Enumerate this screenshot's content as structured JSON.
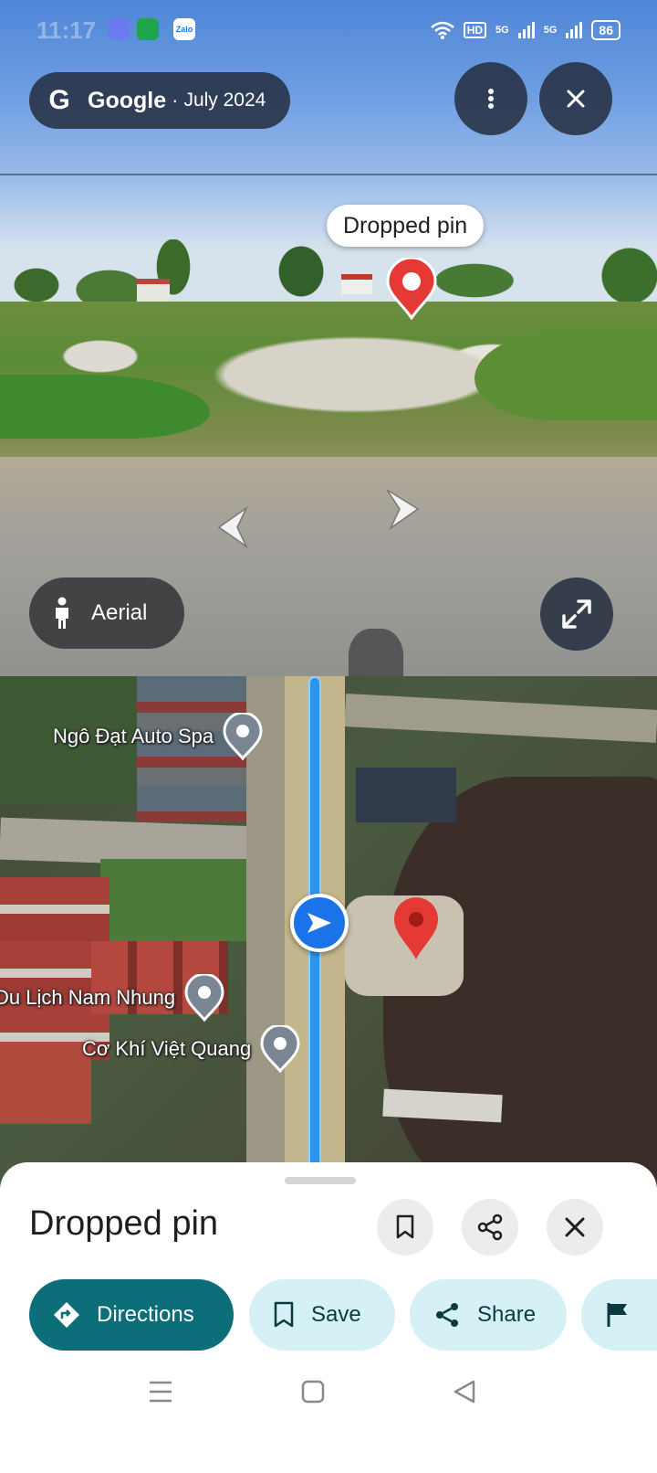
{
  "status_bar": {
    "time": "11:17",
    "network_hd": "HD",
    "network_5g_1": "5G",
    "network_5g_2": "5G",
    "battery": "86",
    "zalo_label": "Zalo"
  },
  "street_view": {
    "attribution_brand": "Google",
    "attribution_separator": "·",
    "attribution_date": "July 2024",
    "place_label": "Dropped pin",
    "aerial_label": "Aerial",
    "icons": {
      "more": "more-vertical-icon",
      "close": "close-icon",
      "expand": "expand-icon",
      "person": "person-icon",
      "nav_left": "chevron-left-icon",
      "nav_right": "chevron-right-icon",
      "pin": "red-pin-icon"
    }
  },
  "map": {
    "pois": [
      {
        "label": "Ngô Đạt Auto Spa"
      },
      {
        "label": "Du Lịch Nam Nhung"
      },
      {
        "label": "Cơ Khí Việt Quang"
      }
    ],
    "colors": {
      "route": "#2e93ec",
      "pin": "#e53935",
      "nav": "#1a73e8"
    }
  },
  "sheet": {
    "title": "Dropped pin",
    "actions": {
      "directions": "Directions",
      "save": "Save",
      "share": "Share"
    },
    "colors": {
      "primary": "#0b6e79",
      "tonal": "#d5f1f6"
    }
  }
}
